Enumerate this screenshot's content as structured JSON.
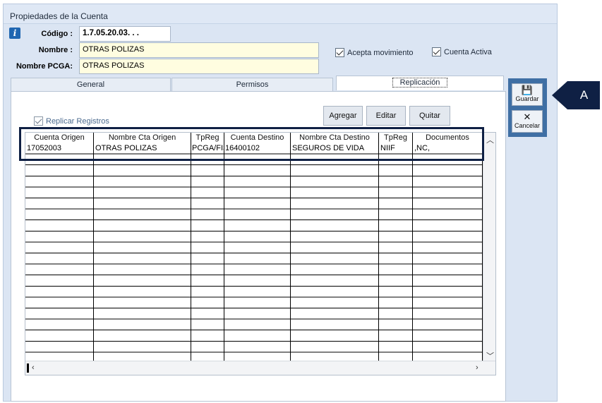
{
  "window": {
    "title": "Propiedades de la Cuenta"
  },
  "form": {
    "codigo_label": "Código :",
    "codigo_value": "1.7.05.20.03. . .",
    "nombre_label": "Nombre :",
    "nombre_value": "OTRAS POLIZAS",
    "nombre_pcga_label": "Nombre PCGA:",
    "nombre_pcga_value": "OTRAS POLIZAS",
    "acepta_movimiento": "Acepta movimiento",
    "cuenta_activa": "Cuenta Activa"
  },
  "tabs": [
    {
      "label": "General"
    },
    {
      "label": "Permisos"
    },
    {
      "label": "Replicación"
    }
  ],
  "replicacion": {
    "replicar_registros": "Replicar Registros",
    "agregar": "Agregar",
    "editar": "Editar",
    "quitar": "Quitar",
    "columns": [
      "Cuenta Origen",
      "Nombre Cta Origen",
      "TpReg",
      "Cuenta Destino",
      "Nombre Cta Destino",
      "TpReg",
      "Documentos"
    ],
    "rows": [
      [
        "17052003",
        "OTRAS POLIZAS",
        "PCGA/FIS",
        "16400102",
        "SEGUROS DE VIDA",
        "NIIF",
        ",NC,"
      ]
    ]
  },
  "side": {
    "guardar": "Guardar",
    "cancelar": "Cancelar"
  },
  "callout": {
    "label": "A"
  },
  "colors": {
    "callout": "#0f2044",
    "accent": "#3f6fa4"
  }
}
